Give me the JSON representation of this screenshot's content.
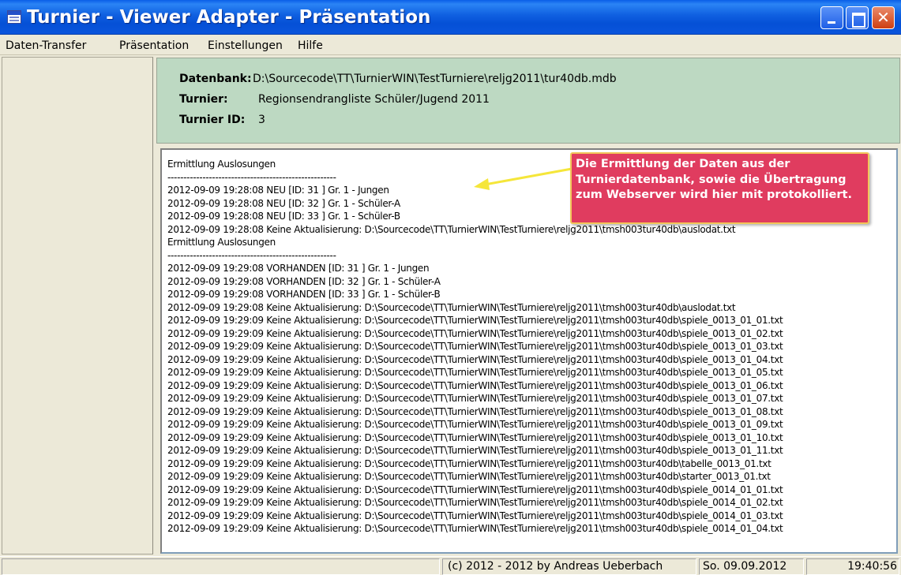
{
  "window": {
    "title": "Turnier - Viewer Adapter - Präsentation"
  },
  "menu": {
    "items": [
      "Daten-Transfer",
      "Präsentation",
      "Einstellungen",
      "Hilfe"
    ]
  },
  "info": {
    "db_label": "Datenbank:",
    "db_value": "D:\\Sourcecode\\TT\\TurnierWIN\\TestTurniere\\reljg2011\\tur40db.mdb",
    "turnier_label": "Turnier:",
    "turnier_value": "Regionsendrangliste Schüler/Jugend 2011",
    "id_label": "Turnier ID:",
    "id_value": "3"
  },
  "log": {
    "lines": [
      "Ermittlung Auslosungen",
      "-----------------------------------------------------",
      "2012-09-09 19:28:08 NEU [ID: 31 ] Gr. 1 - Jungen",
      "2012-09-09 19:28:08 NEU [ID: 32 ] Gr. 1 - Schüler-A",
      "2012-09-09 19:28:08 NEU [ID: 33 ] Gr. 1 - Schüler-B",
      "2012-09-09 19:28:08 Keine Aktualisierung: D:\\Sourcecode\\TT\\TurnierWIN\\TestTurniere\\reljg2011\\tmsh003tur40db\\auslodat.txt",
      "Ermittlung Auslosungen",
      "-----------------------------------------------------",
      "2012-09-09 19:29:08 VORHANDEN [ID: 31 ] Gr. 1 - Jungen",
      "2012-09-09 19:29:08 VORHANDEN [ID: 32 ] Gr. 1 - Schüler-A",
      "2012-09-09 19:29:08 VORHANDEN [ID: 33 ] Gr. 1 - Schüler-B",
      "2012-09-09 19:29:08 Keine Aktualisierung: D:\\Sourcecode\\TT\\TurnierWIN\\TestTurniere\\reljg2011\\tmsh003tur40db\\auslodat.txt",
      "2012-09-09 19:29:09 Keine Aktualisierung: D:\\Sourcecode\\TT\\TurnierWIN\\TestTurniere\\reljg2011\\tmsh003tur40db\\spiele_0013_01_01.txt",
      "2012-09-09 19:29:09 Keine Aktualisierung: D:\\Sourcecode\\TT\\TurnierWIN\\TestTurniere\\reljg2011\\tmsh003tur40db\\spiele_0013_01_02.txt",
      "2012-09-09 19:29:09 Keine Aktualisierung: D:\\Sourcecode\\TT\\TurnierWIN\\TestTurniere\\reljg2011\\tmsh003tur40db\\spiele_0013_01_03.txt",
      "2012-09-09 19:29:09 Keine Aktualisierung: D:\\Sourcecode\\TT\\TurnierWIN\\TestTurniere\\reljg2011\\tmsh003tur40db\\spiele_0013_01_04.txt",
      "2012-09-09 19:29:09 Keine Aktualisierung: D:\\Sourcecode\\TT\\TurnierWIN\\TestTurniere\\reljg2011\\tmsh003tur40db\\spiele_0013_01_05.txt",
      "2012-09-09 19:29:09 Keine Aktualisierung: D:\\Sourcecode\\TT\\TurnierWIN\\TestTurniere\\reljg2011\\tmsh003tur40db\\spiele_0013_01_06.txt",
      "2012-09-09 19:29:09 Keine Aktualisierung: D:\\Sourcecode\\TT\\TurnierWIN\\TestTurniere\\reljg2011\\tmsh003tur40db\\spiele_0013_01_07.txt",
      "2012-09-09 19:29:09 Keine Aktualisierung: D:\\Sourcecode\\TT\\TurnierWIN\\TestTurniere\\reljg2011\\tmsh003tur40db\\spiele_0013_01_08.txt",
      "2012-09-09 19:29:09 Keine Aktualisierung: D:\\Sourcecode\\TT\\TurnierWIN\\TestTurniere\\reljg2011\\tmsh003tur40db\\spiele_0013_01_09.txt",
      "2012-09-09 19:29:09 Keine Aktualisierung: D:\\Sourcecode\\TT\\TurnierWIN\\TestTurniere\\reljg2011\\tmsh003tur40db\\spiele_0013_01_10.txt",
      "2012-09-09 19:29:09 Keine Aktualisierung: D:\\Sourcecode\\TT\\TurnierWIN\\TestTurniere\\reljg2011\\tmsh003tur40db\\spiele_0013_01_11.txt",
      "2012-09-09 19:29:09 Keine Aktualisierung: D:\\Sourcecode\\TT\\TurnierWIN\\TestTurniere\\reljg2011\\tmsh003tur40db\\tabelle_0013_01.txt",
      "2012-09-09 19:29:09 Keine Aktualisierung: D:\\Sourcecode\\TT\\TurnierWIN\\TestTurniere\\reljg2011\\tmsh003tur40db\\starter_0013_01.txt",
      "2012-09-09 19:29:09 Keine Aktualisierung: D:\\Sourcecode\\TT\\TurnierWIN\\TestTurniere\\reljg2011\\tmsh003tur40db\\spiele_0014_01_01.txt",
      "2012-09-09 19:29:09 Keine Aktualisierung: D:\\Sourcecode\\TT\\TurnierWIN\\TestTurniere\\reljg2011\\tmsh003tur40db\\spiele_0014_01_02.txt",
      "2012-09-09 19:29:09 Keine Aktualisierung: D:\\Sourcecode\\TT\\TurnierWIN\\TestTurniere\\reljg2011\\tmsh003tur40db\\spiele_0014_01_03.txt",
      "2012-09-09 19:29:09 Keine Aktualisierung: D:\\Sourcecode\\TT\\TurnierWIN\\TestTurniere\\reljg2011\\tmsh003tur40db\\spiele_0014_01_04.txt"
    ]
  },
  "callout": {
    "text": "Die Ermittlung der Daten aus der Turnierdatenbank, sowie die Übertragung zum Webserver wird hier mit protokolliert."
  },
  "status": {
    "copyright": "(c) 2012 - 2012 by Andreas Ueberbach",
    "date": "So. 09.09.2012",
    "time": "19:40:56"
  },
  "colors": {
    "info_panel_bg": "#bdd9c2",
    "callout_bg": "#e03c5f",
    "callout_border": "#f2c65a",
    "arrow": "#f5e63a"
  },
  "icons": {
    "app": "app-window-icon",
    "minimize": "minimize-icon",
    "maximize": "maximize-icon",
    "close": "close-icon"
  }
}
